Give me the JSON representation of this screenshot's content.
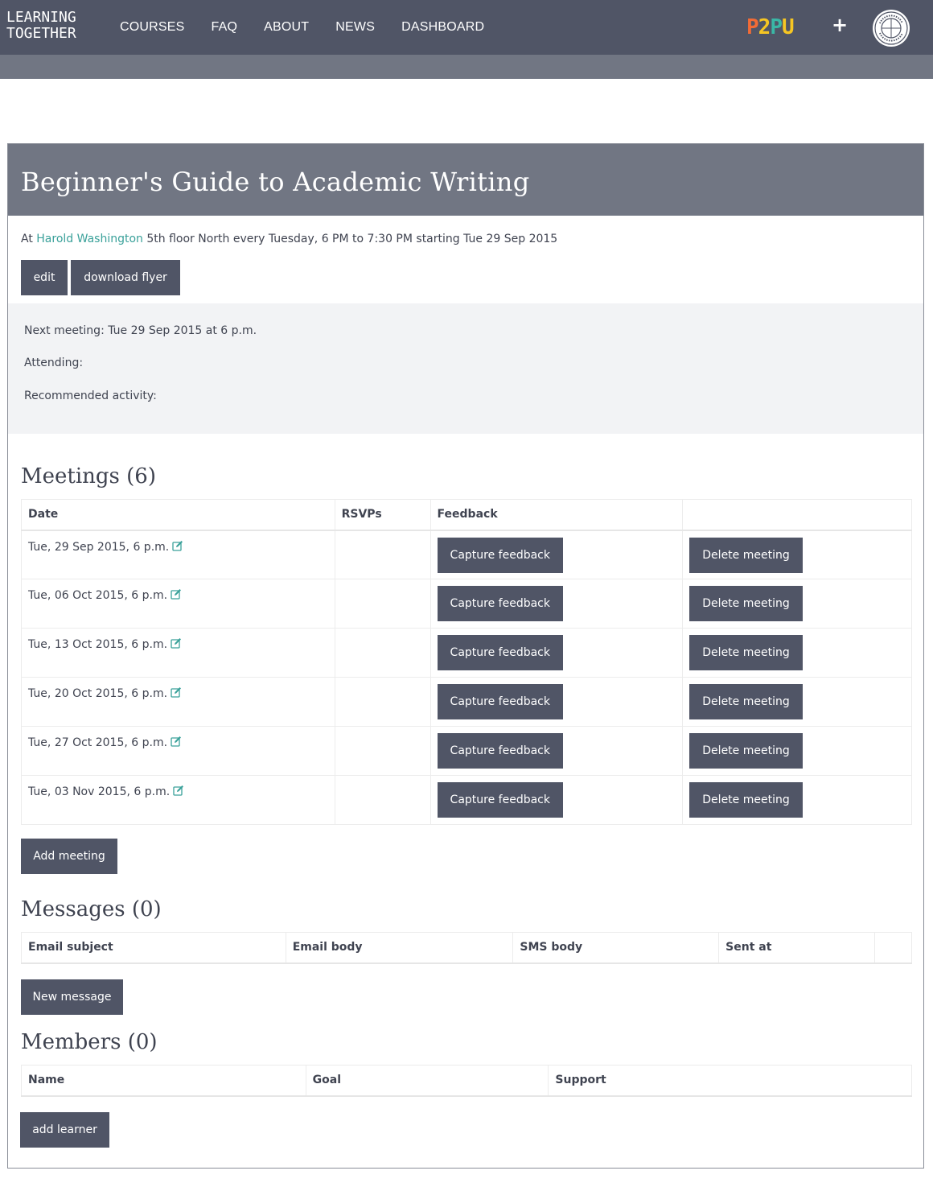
{
  "nav": {
    "brand_line1": "LEARNING",
    "brand_line2": "TOGETHER",
    "links": [
      "COURSES",
      "FAQ",
      "ABOUT",
      "NEWS",
      "DASHBOARD"
    ],
    "p2pu": [
      "P",
      "2",
      "P",
      "U"
    ],
    "plus": "+",
    "logo_icon": "chicago-public-library-logo"
  },
  "course": {
    "title": "Beginner's Guide to Academic Writing",
    "at_prefix": "At",
    "location_link": "Harold Washington",
    "schedule": "5th floor North every Tuesday, 6 PM to 7:30 PM starting Tue 29 Sep 2015",
    "edit_label": "edit",
    "flyer_label": "download flyer"
  },
  "next_meeting": {
    "meeting": "Next meeting: Tue 29 Sep 2015 at 6 p.m.",
    "attending": "Attending:",
    "activity": "Recommended activity:"
  },
  "meetings": {
    "title": "Meetings (6)",
    "headers": [
      "Date",
      "RSVPs",
      "Feedback",
      ""
    ],
    "rows": [
      {
        "date": "Tue, 29 Sep 2015, 6 p.m.",
        "rsvps": "",
        "feedback": "Capture feedback",
        "delete": "Delete meeting"
      },
      {
        "date": "Tue, 06 Oct 2015, 6 p.m.",
        "rsvps": "",
        "feedback": "Capture feedback",
        "delete": "Delete meeting"
      },
      {
        "date": "Tue, 13 Oct 2015, 6 p.m.",
        "rsvps": "",
        "feedback": "Capture feedback",
        "delete": "Delete meeting"
      },
      {
        "date": "Tue, 20 Oct 2015, 6 p.m.",
        "rsvps": "",
        "feedback": "Capture feedback",
        "delete": "Delete meeting"
      },
      {
        "date": "Tue, 27 Oct 2015, 6 p.m.",
        "rsvps": "",
        "feedback": "Capture feedback",
        "delete": "Delete meeting"
      },
      {
        "date": "Tue, 03 Nov 2015, 6 p.m.",
        "rsvps": "",
        "feedback": "Capture feedback",
        "delete": "Delete meeting"
      }
    ],
    "add_label": "Add meeting"
  },
  "messages": {
    "title": "Messages (0)",
    "headers": [
      "Email subject",
      "Email body",
      "SMS body",
      "Sent at",
      ""
    ],
    "new_label": "New message"
  },
  "members": {
    "title": "Members (0)",
    "headers": [
      "Name",
      "Goal",
      "Support"
    ],
    "add_label": "add learner"
  },
  "colors": {
    "navbar": "#505566",
    "subbar": "#717683",
    "button": "#505566",
    "link": "#3aa19a",
    "highlight_box": "#f2f3f5"
  }
}
